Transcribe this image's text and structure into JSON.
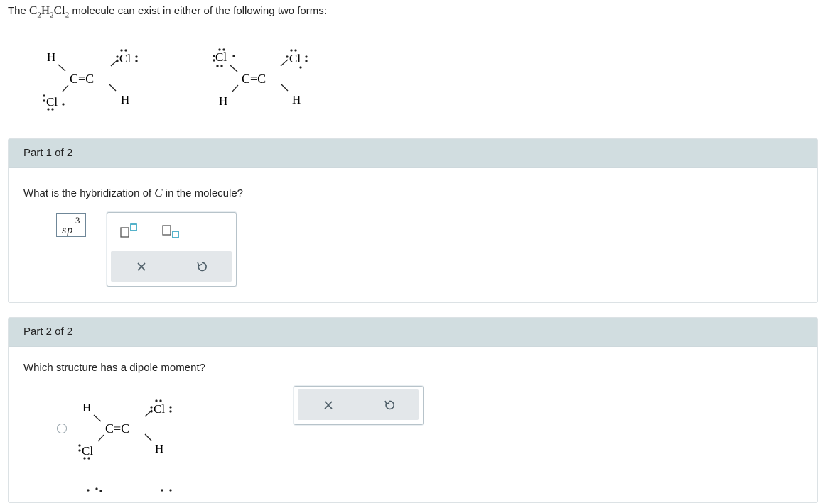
{
  "intro": {
    "prefix": "The",
    "formula": {
      "c": "C",
      "c_sub": "2",
      "h": "H",
      "h_sub": "2",
      "cl": "Cl",
      "cl_sub": "2"
    },
    "suffix": "molecule can exist in either of the following two forms:"
  },
  "structures": {
    "cis": {
      "left_top": "H",
      "right_top": "Cl",
      "left_bottom": "Cl",
      "right_bottom": "H",
      "bond": "C=C"
    },
    "trans": {
      "left_top": "Cl",
      "right_top": "Cl",
      "left_bottom": "H",
      "right_bottom": "H",
      "bond": "C=C"
    }
  },
  "part1": {
    "header": "Part 1 of 2",
    "question_before": "What is the hybridization of",
    "question_var": "C",
    "question_after": "in the molecule?",
    "answer": {
      "base": "sp",
      "superscript": "3"
    },
    "toolbar": {
      "superscript_icon": "superscript-icon",
      "subscript_icon": "subscript-icon",
      "clear_icon": "clear-icon",
      "undo_icon": "undo-icon"
    }
  },
  "part2": {
    "header": "Part 2 of 2",
    "question": "Which structure has a dipole moment?",
    "option1": {
      "left_top": "H",
      "right_top": "Cl",
      "left_bottom": "Cl",
      "right_bottom": "H",
      "bond": "C=C",
      "selected": false
    },
    "toolbar": {
      "clear_icon": "clear-icon",
      "undo_icon": "undo-icon"
    }
  },
  "colors": {
    "header_bg": "#d1dde0",
    "accent": "#2a9fbd",
    "border": "#b7c3ca"
  }
}
